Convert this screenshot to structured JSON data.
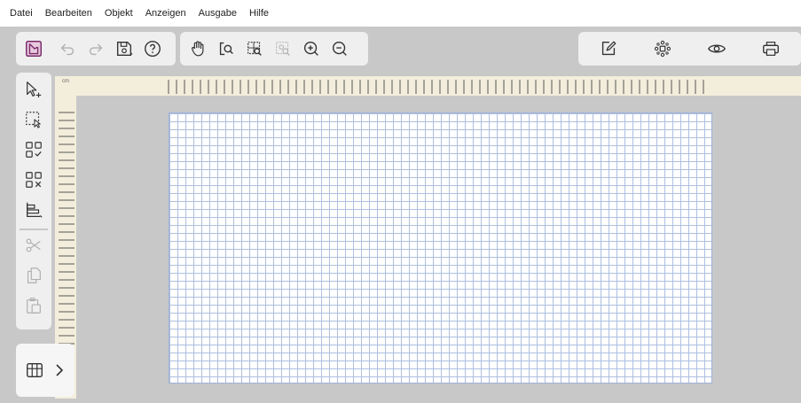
{
  "menu": {
    "items": [
      "Datei",
      "Bearbeiten",
      "Objekt",
      "Anzeigen",
      "Ausgabe",
      "Hilfe"
    ]
  },
  "toolbar": {
    "left_group": [
      {
        "icon": "app-logo-icon",
        "color": "#7a2a6a"
      },
      {
        "icon": "undo-icon",
        "enabled": false
      },
      {
        "icon": "redo-icon",
        "enabled": false
      },
      {
        "icon": "save-icon"
      },
      {
        "icon": "help-icon"
      }
    ],
    "view_group": [
      {
        "icon": "hand-pan-icon"
      },
      {
        "icon": "zoom-page-icon"
      },
      {
        "icon": "zoom-selection-icon"
      },
      {
        "icon": "zoom-object-icon",
        "enabled": false
      },
      {
        "icon": "zoom-in-icon"
      },
      {
        "icon": "zoom-out-icon"
      }
    ],
    "right_group": [
      {
        "icon": "edit-icon"
      },
      {
        "icon": "arrange-icon"
      },
      {
        "icon": "preview-icon"
      },
      {
        "icon": "print-icon"
      }
    ]
  },
  "sidebar": {
    "tools": [
      {
        "icon": "add-select-icon"
      },
      {
        "icon": "marquee-select-icon"
      },
      {
        "icon": "select-all-icon"
      },
      {
        "icon": "deselect-all-icon"
      },
      {
        "icon": "align-icon"
      },
      {
        "icon": "cut-icon",
        "enabled": false
      },
      {
        "icon": "copy-icon",
        "enabled": false
      },
      {
        "icon": "paste-icon",
        "enabled": false
      }
    ],
    "bottom": {
      "icon": "grid-panel-icon",
      "chevron": "chevron-right-icon"
    }
  },
  "ruler": {
    "unit": "cm"
  },
  "colors": {
    "accent": "#7a2a6a",
    "grid_line": "#aebfe0",
    "ruler_bg": "#f3eedc",
    "workspace": "#c8c8c8"
  }
}
